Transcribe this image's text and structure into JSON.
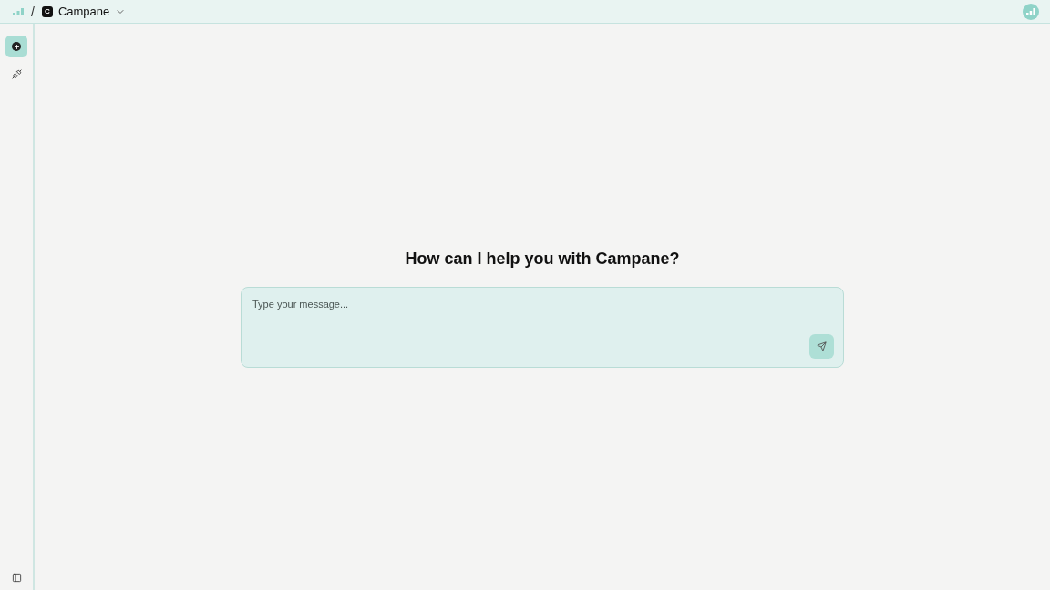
{
  "breadcrumb": {
    "separator": "/",
    "project_initial": "C",
    "project_name": "Campane"
  },
  "sidebar": {
    "items": [
      {
        "kind": "new-chat",
        "selected": true
      },
      {
        "kind": "integrations",
        "selected": false
      }
    ]
  },
  "heading": "How can I help you with Campane?",
  "composer": {
    "placeholder": "Type your message..."
  }
}
